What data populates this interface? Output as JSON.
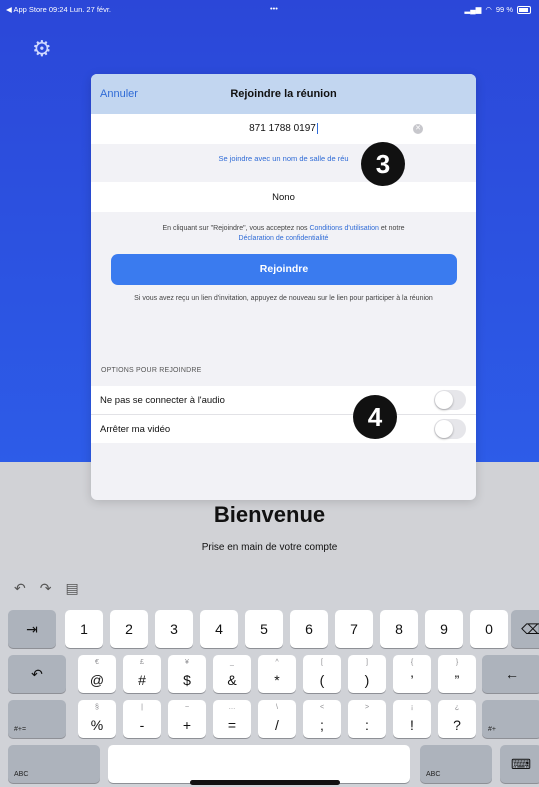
{
  "status": {
    "left": "◀ App Store  09:24  Lun. 27 févr.",
    "dots": "•••",
    "battery": "99 %"
  },
  "modal": {
    "cancel": "Annuler",
    "title": "Rejoindre la réunion",
    "meeting_id": "871 1788 0197",
    "join_with_room": "Se joindre avec un nom de salle de réu",
    "name": "Nono",
    "terms_prefix": "En cliquant sur \"Rejoindre\", vous acceptez nos ",
    "terms_link": "Conditions d'utilisation",
    "terms_mid": " et notre",
    "privacy_link": "Déclaration de confidentialité",
    "join_button": "Rejoindre",
    "hint": "Si vous avez reçu un lien d'invitation, appuyez de nouveau sur le lien pour participer à la réunion",
    "options_header": "OPTIONS POUR REJOINDRE",
    "option_audio": "Ne pas se connecter à l'audio",
    "option_video": "Arrêter ma vidéo",
    "audio_on": false,
    "video_on": false
  },
  "badges": [
    "3",
    "4"
  ],
  "welcome": {
    "title": "Bienvenue",
    "subtitle": "Prise en main de votre compte"
  },
  "keyboard": {
    "row1": [
      "1",
      "2",
      "3",
      "4",
      "5",
      "6",
      "7",
      "8",
      "9",
      "0"
    ],
    "row2_alt": [
      "€",
      "£",
      "¥",
      "_",
      "^",
      "[",
      "]",
      "{",
      "}"
    ],
    "row2": [
      "@",
      "#",
      "$",
      "&",
      "*",
      "(",
      ")",
      "’",
      "”"
    ],
    "row3_alt": [
      "§",
      "|",
      "~",
      "…",
      "\\",
      "<",
      ">",
      "¡",
      "¿"
    ],
    "row3": [
      "%",
      "-",
      "+",
      "=",
      "/",
      ";",
      ":",
      "!",
      "?"
    ],
    "row3_sub": [
      "",
      "",
      "",
      "",
      "",
      "",
      "",
      ",",
      "."
    ],
    "left_mod": "#+=",
    "right_mod": "#+",
    "abc_left": "ABC",
    "abc_right": "ABC"
  }
}
